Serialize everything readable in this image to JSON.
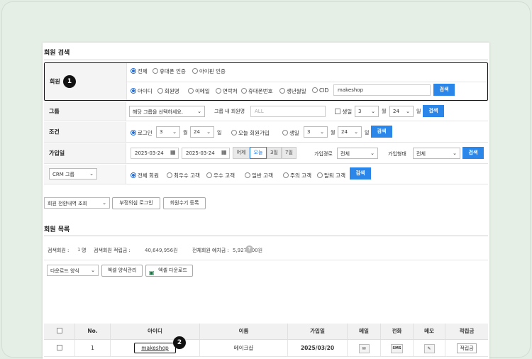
{
  "member_search": {
    "title": "회원 검색",
    "member_row": {
      "label": "회원",
      "auth_options": [
        "전체",
        "휴대폰 인증",
        "아이핀 인증"
      ],
      "field_options": [
        "아이디",
        "회원명",
        "이메일",
        "연락처",
        "휴대폰번호",
        "생년월일",
        "CID"
      ],
      "keyword": "makeshop",
      "search": "검색",
      "callout": "1"
    },
    "group_row": {
      "label": "그룹",
      "group_select": "해당 그룹을 선택하세요.",
      "group_member_label": "그룹 내 회원명",
      "group_member_placeholder": "ALL",
      "birthday_label": "생일",
      "month": "3",
      "month_unit": "월",
      "day": "24",
      "day_unit": "일",
      "search": "검색"
    },
    "condition_row": {
      "label": "조건",
      "login_label": "로그인",
      "month": "3",
      "month_unit": "월",
      "day": "24",
      "day_unit": "일",
      "today_join": "오늘 회원가입",
      "birthday_label": "생일",
      "month2": "3",
      "day2": "24",
      "search": "검색"
    },
    "join_row": {
      "label": "가입일",
      "date_from": "2025-03-24",
      "date_to": "2025-03-24",
      "presets": [
        "어제",
        "오늘",
        "3일",
        "7일"
      ],
      "route_label": "가입경로",
      "route_value": "전체",
      "type_label": "가입형태",
      "type_value": "전체",
      "search": "검색"
    },
    "crm_row": {
      "crm_select": "CRM 그룹",
      "options": [
        "전체 회원",
        "최우수 고객",
        "우수 고객",
        "일반 고객",
        "주의 고객",
        "탈퇴 고객"
      ],
      "search": "검색"
    }
  },
  "actions": {
    "history_select": "회원 전환내역 조회",
    "suspicious_login": "부정의심 로그인",
    "manual_register": "회원수기 등록"
  },
  "member_list": {
    "title": "회원 목록",
    "stats": {
      "search_label": "검색회원 :",
      "search_count": "1",
      "search_unit": "명",
      "points_label": "검색회원 적립금 :",
      "points_value": "40,649,956원",
      "deposit_label": "전체회원 예치금 :",
      "deposit_value": "5,927,000원",
      "help": "?"
    },
    "download_select": "다운로드 양식",
    "excel_manage": "엑셀 양식관리",
    "excel_download": "엑셀 다운로드",
    "columns": [
      "No.",
      "아이디",
      "이름",
      "가입일",
      "메일",
      "전화",
      "메모",
      "적립금"
    ],
    "rows": [
      {
        "no": "1",
        "id": "makeshop",
        "name": "메이크샵",
        "joined": "2025/03/20",
        "phone": "SMS",
        "points": "적립금"
      }
    ],
    "callout": "2"
  },
  "colors": {
    "accent": "#2a86e8",
    "highlight_border": "#111111",
    "label_bg": "#f4f4f4"
  }
}
